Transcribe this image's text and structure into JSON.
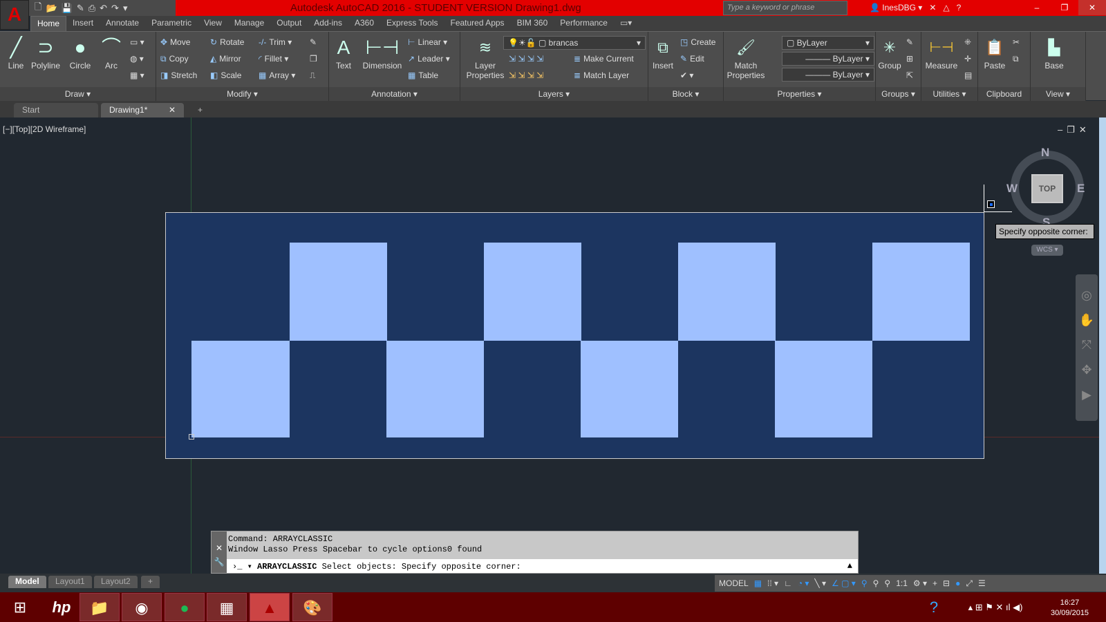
{
  "title": "Autodesk AutoCAD 2016 - STUDENT VERSION    Drawing1.dwg",
  "search_placeholder": "Type a keyword or phrase",
  "user": "InesDBG",
  "ribbon_tabs": [
    "Home",
    "Insert",
    "Annotate",
    "Parametric",
    "View",
    "Manage",
    "Output",
    "Add-ins",
    "A360",
    "Express Tools",
    "Featured Apps",
    "BIM 360",
    "Performance"
  ],
  "draw": {
    "label": "Draw",
    "line": "Line",
    "polyline": "Polyline",
    "circle": "Circle",
    "arc": "Arc"
  },
  "modify": {
    "label": "Modify",
    "move": "Move",
    "rotate": "Rotate",
    "trim": "Trim",
    "copy": "Copy",
    "mirror": "Mirror",
    "fillet": "Fillet",
    "stretch": "Stretch",
    "scale": "Scale",
    "array": "Array"
  },
  "annotation": {
    "label": "Annotation",
    "text": "Text",
    "dimension": "Dimension",
    "linear": "Linear",
    "leader": "Leader",
    "table": "Table"
  },
  "layers": {
    "label": "Layers",
    "layer_properties": "Layer Properties",
    "current_layer": "brancas",
    "make_current": "Make Current",
    "match_layer": "Match Layer"
  },
  "block": {
    "label": "Block",
    "insert": "Insert",
    "create": "Create",
    "edit": "Edit"
  },
  "properties": {
    "label": "Properties",
    "match": "Match Properties",
    "color": "ByLayer",
    "linetype": "ByLayer",
    "lineweight": "ByLayer"
  },
  "groups": {
    "label": "Groups",
    "group": "Group"
  },
  "utilities": {
    "label": "Utilities",
    "measure": "Measure"
  },
  "clipboard": {
    "label": "Clipboard",
    "paste": "Paste"
  },
  "view": {
    "label": "View",
    "base": "Base"
  },
  "file_tabs": [
    "Start",
    "Drawing1*"
  ],
  "viewport_label": "[−][Top][2D Wireframe]",
  "viewcube": {
    "n": "N",
    "s": "S",
    "e": "E",
    "w": "W",
    "face": "TOP",
    "wcs": "WCS"
  },
  "tooltip": "Specify opposite corner:",
  "command": {
    "history": [
      "Command: ARRAYCLASSIC",
      "Window Lasso  Press Spacebar to cycle options0 found"
    ],
    "prompt_cmd": "ARRAYCLASSIC",
    "prompt": "Select objects: Specify opposite corner:"
  },
  "layout_tabs": [
    "Model",
    "Layout1",
    "Layout2"
  ],
  "status": {
    "model": "MODEL",
    "scale": "1:1"
  },
  "clock": {
    "time": "16:27",
    "date": "30/09/2015"
  },
  "colors": {
    "accent": "#e30000",
    "selection": "#1c3560",
    "squares": "#9fc0ff"
  }
}
